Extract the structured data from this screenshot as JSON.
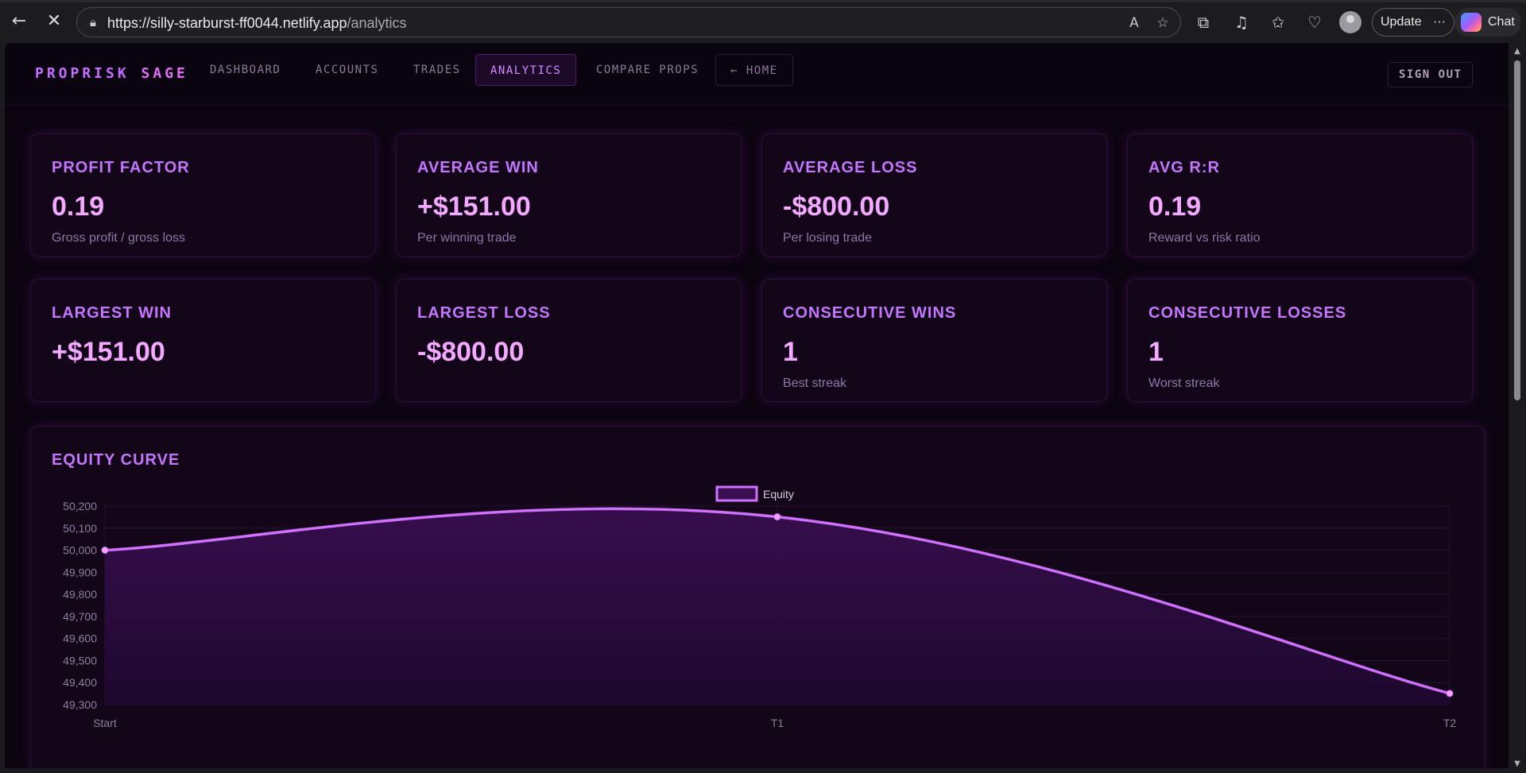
{
  "browser": {
    "url_host": "https://silly-starburst-ff0044.netlify.app",
    "url_path": "/analytics",
    "update_label": "Update",
    "chat_label": "Chat",
    "icons": [
      "back-icon",
      "close-icon",
      "lock-icon",
      "read-aloud-icon",
      "favorite-star-icon",
      "extensions-icon",
      "media-icon",
      "favorites-icon",
      "health-icon",
      "profile-icon",
      "more-icon",
      "copilot-icon"
    ]
  },
  "nav": {
    "brand_part1": "PROPRISK",
    "brand_part2": "SAGE",
    "links": [
      "DASHBOARD",
      "ACCOUNTS",
      "TRADES",
      "ANALYTICS",
      "COMPARE PROPS",
      "← HOME"
    ],
    "active": "ANALYTICS",
    "sign_out": "SIGN OUT"
  },
  "stats": [
    {
      "label": "PROFIT FACTOR",
      "value": "0.19",
      "sub": "Gross profit / gross loss"
    },
    {
      "label": "AVERAGE WIN",
      "value": "+$151.00",
      "sub": "Per winning trade"
    },
    {
      "label": "AVERAGE LOSS",
      "value": "-$800.00",
      "sub": "Per losing trade"
    },
    {
      "label": "AVG R:R",
      "value": "0.19",
      "sub": "Reward vs risk ratio"
    },
    {
      "label": "LARGEST WIN",
      "value": "+$151.00",
      "sub": ""
    },
    {
      "label": "LARGEST LOSS",
      "value": "-$800.00",
      "sub": ""
    },
    {
      "label": "CONSECUTIVE WINS",
      "value": "1",
      "sub": "Best streak"
    },
    {
      "label": "CONSECUTIVE LOSSES",
      "value": "1",
      "sub": "Worst streak"
    }
  ],
  "equity_panel": {
    "title": "EQUITY CURVE"
  },
  "colors": {
    "accent": "#c476ff",
    "value": "#f3a9ff",
    "line": "#d070ff",
    "bg": "#0c0410",
    "card": "#130619"
  },
  "chart_data": {
    "type": "area",
    "title": "",
    "categories": [
      "Start",
      "T1",
      "T2"
    ],
    "series": [
      {
        "name": "Equity",
        "values": [
          50000,
          50151,
          49351
        ]
      }
    ],
    "yticks": [
      "50,200",
      "50,100",
      "50,000",
      "49,900",
      "49,800",
      "49,700",
      "49,600",
      "49,500",
      "49,400",
      "49,300"
    ],
    "ylim": [
      49300,
      50200
    ],
    "grid": true,
    "legend": "top-center"
  }
}
